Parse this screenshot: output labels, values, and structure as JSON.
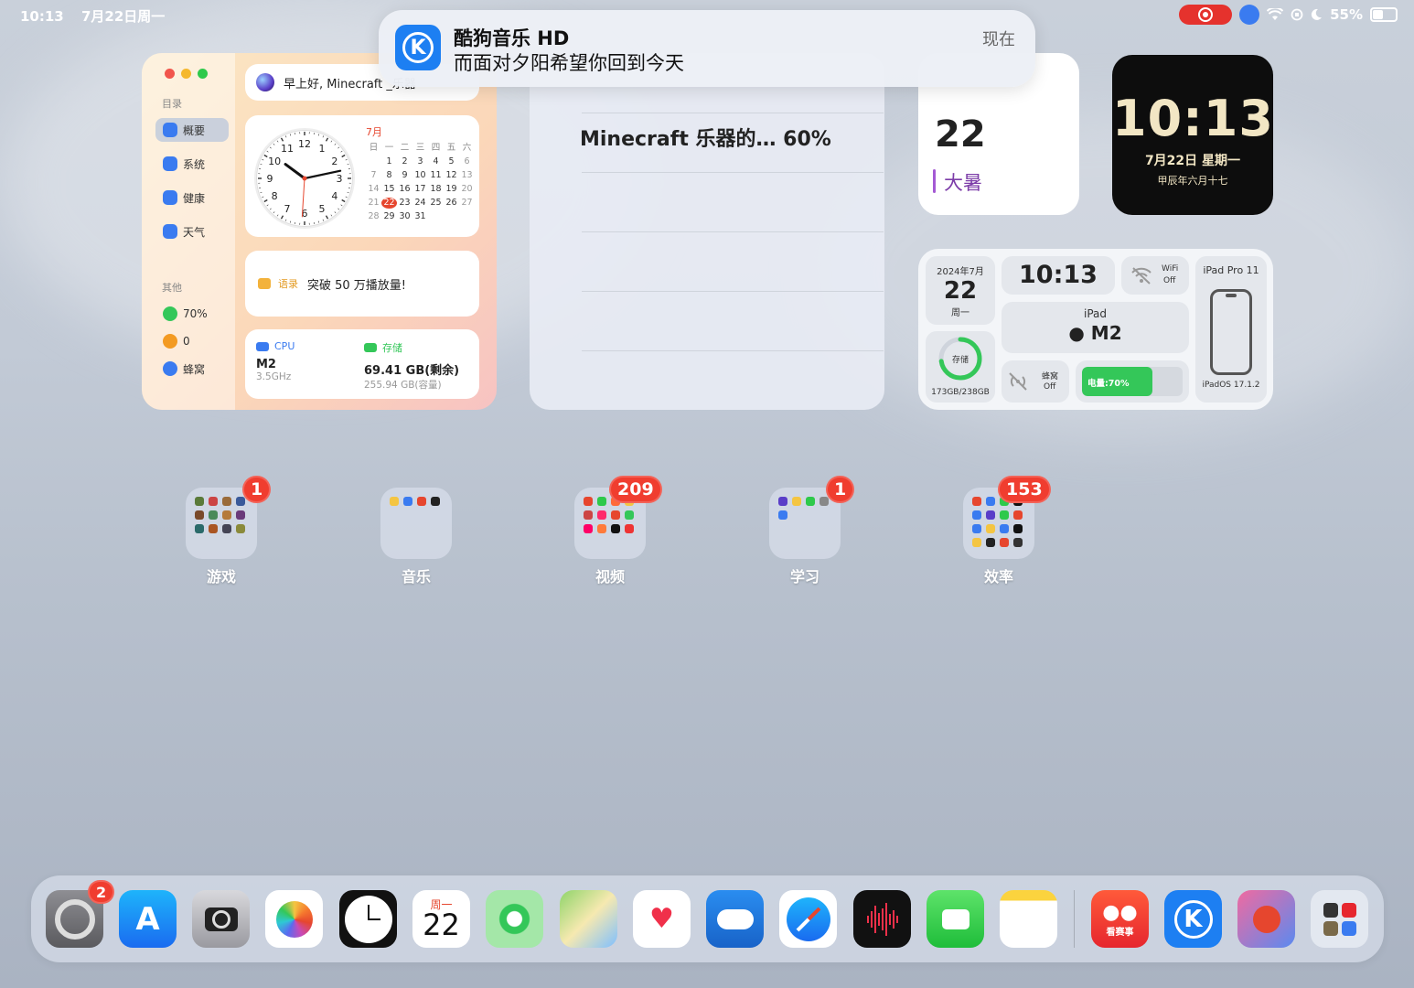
{
  "status_bar": {
    "time": "10:13",
    "date": "7月22日周一",
    "battery_percent": "55%",
    "battery_level": 0.55
  },
  "notification": {
    "app": "酷狗音乐 HD",
    "message": "而面对夕阳希望你回到今天",
    "time": "现在",
    "icon_letter": "K"
  },
  "system_widget": {
    "section_dir": "目录",
    "nav": [
      {
        "label": "概要",
        "icon": "overview-icon",
        "color": "#3a7bf0"
      },
      {
        "label": "系统",
        "icon": "gear-icon",
        "color": "#3a7bf0"
      },
      {
        "label": "健康",
        "icon": "heart-icon",
        "color": "#3a7bf0"
      },
      {
        "label": "天气",
        "icon": "weather-icon",
        "color": "#3a7bf0"
      }
    ],
    "section_other": "其他",
    "other": [
      {
        "label": "70%",
        "icon": "battery-icon",
        "color": "#34c759"
      },
      {
        "label": "0",
        "icon": "walk-icon",
        "color": "#f39a22"
      },
      {
        "label": "蜂窝",
        "icon": "globe-icon",
        "color": "#3a7bf0"
      }
    ],
    "greeting": "早上好, Minecraft _乐器",
    "calendar": {
      "month": "7月",
      "weekdays": [
        "日",
        "一",
        "二",
        "三",
        "四",
        "五",
        "六"
      ],
      "days": [
        [
          "",
          "1",
          "2",
          "3",
          "4",
          "5",
          "6"
        ],
        [
          "7",
          "8",
          "9",
          "10",
          "11",
          "12",
          "13"
        ],
        [
          "14",
          "15",
          "16",
          "17",
          "18",
          "19",
          "20"
        ],
        [
          "21",
          "22",
          "23",
          "24",
          "25",
          "26",
          "27"
        ],
        [
          "28",
          "29",
          "30",
          "31",
          "",
          "",
          ""
        ]
      ],
      "today": "22"
    },
    "clock_numbers": [
      "12",
      "1",
      "2",
      "3",
      "4",
      "5",
      "6",
      "7",
      "8",
      "9",
      "10",
      "11"
    ],
    "quote_label": "语录",
    "quote": "突破 50 万播放量!",
    "cpu_label": "CPU",
    "cpu_value": "M2",
    "cpu_sub": "3.5GHz",
    "storage_label": "存储",
    "storage_value": "69.41 GB(剩余)",
    "storage_sub": "255.94 GB(容量)"
  },
  "list_widget": {
    "partial_title": "Minecraft 乐器的…  60%"
  },
  "calendar_widget": {
    "day_partial": "22",
    "solar_term": "大暑"
  },
  "clock_widget": {
    "time": "10:13",
    "date": "7月22日 星期一",
    "lunar": "甲辰年六月十七"
  },
  "device_widget": {
    "date_header": "2024年7月",
    "day": "22",
    "weekday": "周一",
    "time": "10:13",
    "wifi_label": "WiFi",
    "wifi_state": "Off",
    "model": "iPad Pro 11",
    "device": "iPad",
    "chip": "M2",
    "storage_ring_label": "存储",
    "storage_fraction": 0.727,
    "storage_text": "173GB/238GB",
    "cellular_label": "蜂窝",
    "cellular_state": "Off",
    "battery_text": "电量:70%",
    "battery_level": 0.7,
    "os": "iPadOS 17.1.2"
  },
  "folders": [
    {
      "name": "游戏",
      "badge": "1"
    },
    {
      "name": "音乐",
      "badge": ""
    },
    {
      "name": "视频",
      "badge": "209"
    },
    {
      "name": "学习",
      "badge": "1"
    },
    {
      "name": "效率",
      "badge": "153"
    }
  ],
  "dock": {
    "settings_badge": "2",
    "calendar_weekday": "周一",
    "calendar_day": "22",
    "kanshishi_label": "看赛事",
    "apps": [
      "settings-icon",
      "app-store-icon",
      "camera-icon",
      "photos-icon",
      "clock-icon",
      "calendar-icon",
      "find-my-icon",
      "maps-icon",
      "health-icon",
      "weather-icon",
      "safari-icon",
      "voice-memos-icon",
      "facetime-icon",
      "notes-icon",
      "kuaishou-icon",
      "kugou-icon",
      "game-icon",
      "utilities-icon"
    ]
  }
}
